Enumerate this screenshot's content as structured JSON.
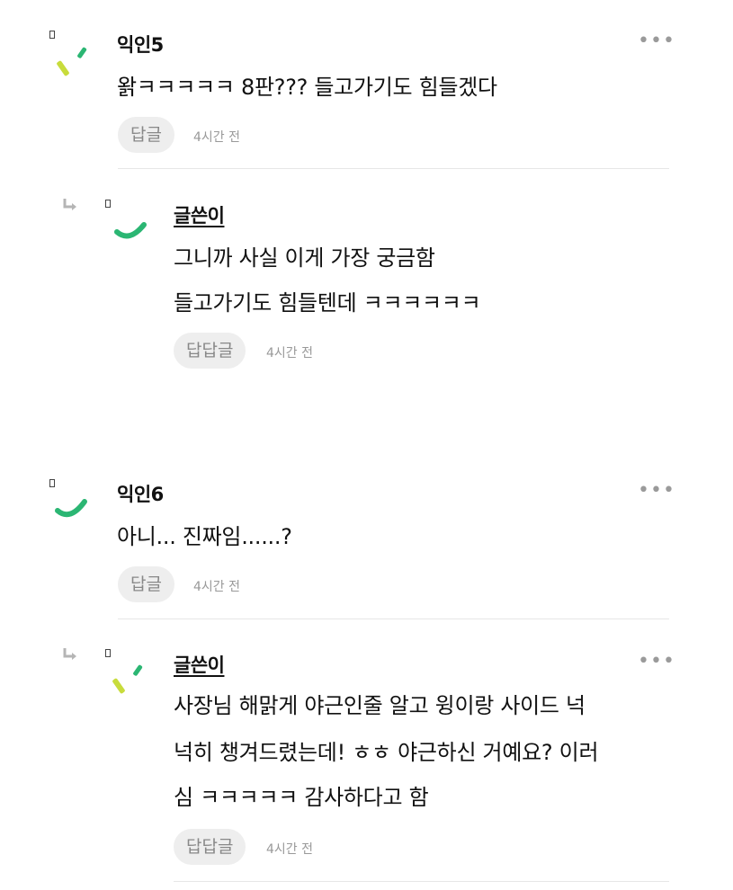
{
  "comments": [
    {
      "nickname": "익인5",
      "avatar": "yellow-green-slash-avatar",
      "lines": [
        "왉ㅋㅋㅋㅋㅋ 8판??? 들고가기도 힘들겠다"
      ],
      "reply_label": "답글",
      "time": "4시간 전",
      "more": "•••"
    },
    {
      "nickname": "글쓴이",
      "avatar": "green-smile-avatar",
      "lines": [
        "그니까 사실 이게 가장 궁금함",
        "들고가기도 힘들텐데 ㅋㅋㅋㅋㅋㅋ"
      ],
      "reply_label": "답답글",
      "time": "4시간 전"
    },
    {
      "nickname": "익인6",
      "avatar": "green-smile-avatar",
      "lines": [
        "아니... 진짜임......?"
      ],
      "reply_label": "답글",
      "time": "4시간 전",
      "more": "•••"
    },
    {
      "nickname": "글쓴이",
      "avatar": "yellow-green-slash-avatar",
      "lines": [
        "사장님 해맑게 야근인줄 알고 윙이랑 사이드 넉",
        "넉히 챙겨드렸는데! ㅎㅎ 야근하신 거예요? 이러",
        "심 ㅋㅋㅋㅋㅋ 감사하다고 함"
      ],
      "reply_label": "답답글",
      "time": "4시간 전",
      "more": "•••"
    }
  ],
  "colors": {
    "accent_green": "#2bb673",
    "accent_yellow": "#c8dc3c",
    "muted_text": "#999999",
    "button_bg": "#eeeeee"
  }
}
